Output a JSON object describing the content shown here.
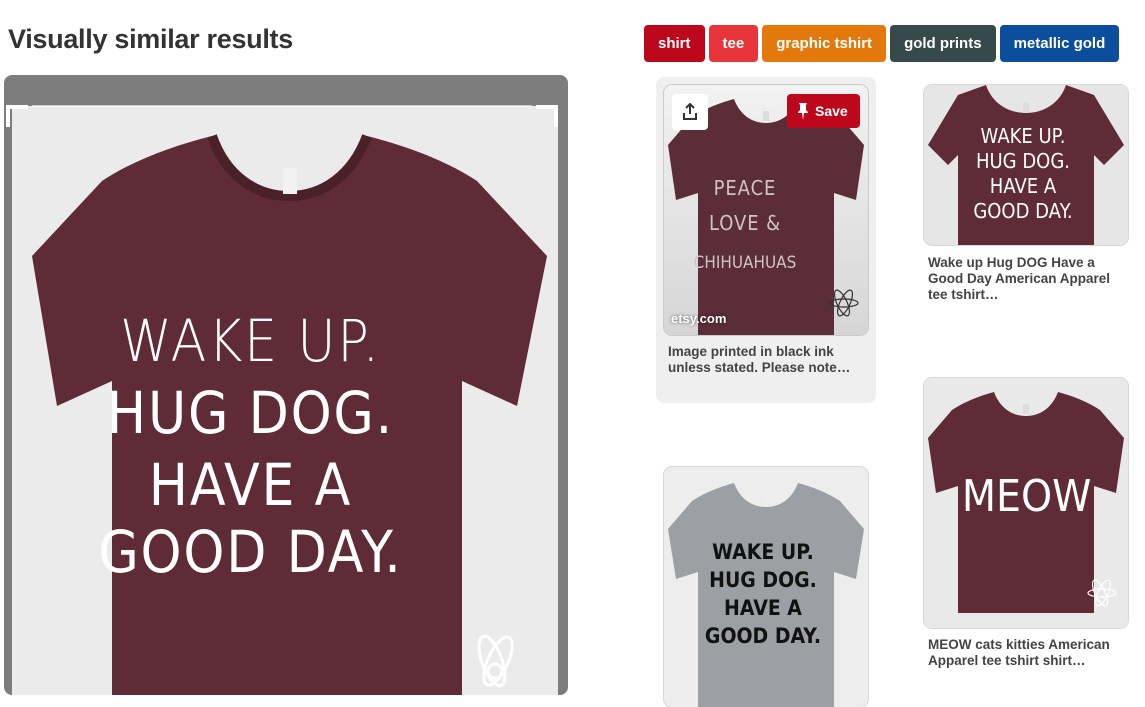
{
  "header": {
    "title": "Visually similar results"
  },
  "tags": [
    {
      "label": "shirt",
      "color": "#bd081c"
    },
    {
      "label": "tee",
      "color": "#e8353b"
    },
    {
      "label": "graphic tshirt",
      "color": "#e3780c"
    },
    {
      "label": "gold prints",
      "color": "#364a4c"
    },
    {
      "label": "metallic gold",
      "color": "#0b4e9b"
    }
  ],
  "main_image": {
    "shirt_lines": [
      "WAKE UP.",
      "HUG DOG.",
      "HAVE A",
      "GOOD DAY."
    ],
    "shirt_color": "#5e2b36"
  },
  "pins": [
    {
      "shirt_lines": [
        "PEACE",
        "LOVE &",
        "CHIHUAHUAS"
      ],
      "source": "etsy.com",
      "save_label": "Save",
      "description": "Image printed in black ink unless stated. Please note…"
    },
    {
      "shirt_lines": [
        "WAKE UP.",
        "HUG DOG.",
        "HAVE A",
        "GOOD DAY."
      ],
      "description": "Wake up Hug DOG Have a Good Day American Apparel tee tshirt…"
    },
    {
      "shirt_lines": [
        "MEOW"
      ],
      "description": "MEOW cats kitties American Apparel tee tshirt shirt…"
    },
    {
      "shirt_lines": [
        "WAKE UP.",
        "HUG DOG.",
        "HAVE A",
        "GOOD DAY."
      ]
    }
  ],
  "icons": {
    "save": "pin-icon",
    "share": "share-icon"
  }
}
